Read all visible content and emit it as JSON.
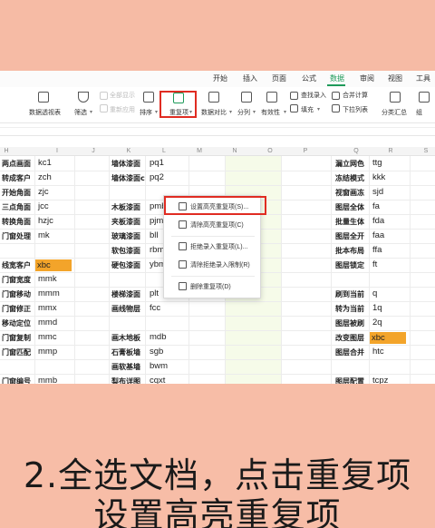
{
  "menu": [
    "开始",
    "插入",
    "页面",
    "公式",
    "数据",
    "审阅",
    "视图",
    "工具"
  ],
  "ribbon": {
    "pivot": "数据透视表",
    "filter": "筛选",
    "show_all": "全部显示",
    "reapply": "重新应用",
    "sort": "排序",
    "duplicates": "重复项",
    "compare": "数据对比",
    "split": "分列",
    "validity": "有效性",
    "lookup": "查找录入",
    "fill": "填充",
    "merge_calc": "合并计算",
    "dropdown_list": "下拉列表",
    "subtotal": "分类汇总",
    "group": "组"
  },
  "columns": [
    "H",
    "I",
    "J",
    "K",
    "L",
    "M",
    "N",
    "O",
    "P",
    "Q",
    "R",
    "S"
  ],
  "rows": [
    {
      "h": "两点画面",
      "i": "kc1",
      "k": "墙体漆面",
      "l": "pq1",
      "q": "漏立网色",
      "r": "ttg"
    },
    {
      "h": "转成客户",
      "i": "zch",
      "k": "墙体漆面c",
      "l": "pq2",
      "q": "冻结模式",
      "r": "kkk"
    },
    {
      "h": "开始角面",
      "i": "zjc",
      "k": "",
      "l": "",
      "q": "视窗画冻",
      "r": "sjd"
    },
    {
      "h": "三点角面",
      "i": "jcc",
      "k": "木板漆面",
      "l": "pmb",
      "q": "图层全体",
      "r": "fa"
    },
    {
      "h": "转换角面",
      "i": "hzjc",
      "k": "夹板漆面",
      "l": "pjm",
      "q": "批量生体",
      "r": "fda"
    },
    {
      "h": "门窗处理",
      "i": "mk",
      "k": "玻璃漆面",
      "l": "bll",
      "q": "图层全开",
      "r": "faa"
    },
    {
      "h": "",
      "i": "",
      "k": "软包漆面",
      "l": "rbm",
      "q": "批本布局",
      "r": "ffa"
    },
    {
      "h": "线宽客户",
      "i": "xbc",
      "k": "硬包漆面",
      "l": "ybm",
      "q": "图层锁定",
      "r": "ft"
    },
    {
      "h": "门窗宽度",
      "i": "mmk",
      "k": "",
      "l": "",
      "q": "",
      "r": ""
    },
    {
      "h": "门窗移动",
      "i": "mmm",
      "k": "楼梯漆面",
      "l": "plt",
      "q": "刷到当前",
      "r": "q"
    },
    {
      "h": "门窗修正",
      "i": "mmx",
      "k": "画线物层",
      "l": "fcc",
      "q": "转为当前",
      "r": "1q"
    },
    {
      "h": "移动定位",
      "i": "mmd",
      "k": "",
      "l": "",
      "q": "图层被刷",
      "r": "2q"
    },
    {
      "h": "门窗复制",
      "i": "mmc",
      "k": "画木地板",
      "l": "mdb",
      "q": "改变图层",
      "r": "xbc"
    },
    {
      "h": "门窗匹配",
      "i": "mmp",
      "k": "石膏板墙",
      "l": "sgb",
      "q": "图层合并",
      "r": "htc"
    },
    {
      "h": "",
      "i": "",
      "k": "画软基墙",
      "l": "bwm",
      "q": "",
      "r": ""
    },
    {
      "h": "门窗编号",
      "i": "mmb",
      "k": "梨布详图",
      "l": "cqxt",
      "q": "图层配置",
      "r": "tcpz"
    }
  ],
  "dropdown": [
    "设置高亮重复项(S)...",
    "清除高亮重复项(C)",
    "拒绝录入重复项(L)...",
    "清除拒绝录入限制(R)",
    "删除重复项(D)"
  ],
  "caption": {
    "line1": "2.全选文档，点击重复项",
    "line2": "设置高亮重复项"
  },
  "colors": {
    "accent": "#1e9b5a",
    "highlight_cell": "#f3a42a",
    "callout": "#e02c22",
    "background": "#f6bba5"
  }
}
